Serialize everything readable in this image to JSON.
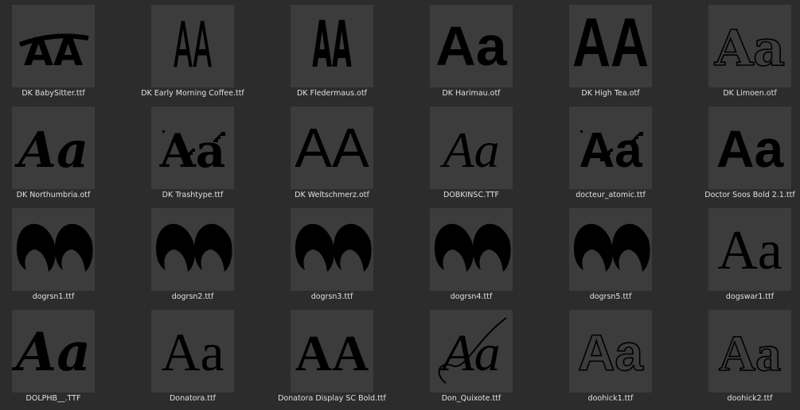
{
  "files": [
    {
      "name": "DK BabySitter.ttf",
      "glyph": "AA"
    },
    {
      "name": "DK Early Morning Coffee.ttf",
      "glyph": "AA"
    },
    {
      "name": "DK Fledermaus.otf",
      "glyph": "AA"
    },
    {
      "name": "DK Harimau.otf",
      "glyph": "Aa"
    },
    {
      "name": "DK High Tea.otf",
      "glyph": "AA"
    },
    {
      "name": "DK Limoen.otf",
      "glyph": "Aa"
    },
    {
      "name": "DK Northumbria.otf",
      "glyph": "Aa"
    },
    {
      "name": "DK Trashtype.ttf",
      "glyph": "Aa"
    },
    {
      "name": "DK Weltschmerz.otf",
      "glyph": "AA"
    },
    {
      "name": "DOBKINSC.TTF",
      "glyph": "Aa"
    },
    {
      "name": "docteur_atomic.ttf",
      "glyph": "Aa"
    },
    {
      "name": "Doctor Soos Bold 2.1.ttf",
      "glyph": "Aa"
    },
    {
      "name": "dogrsn1.ttf",
      "glyph": ""
    },
    {
      "name": "dogrsn2.ttf",
      "glyph": ""
    },
    {
      "name": "dogrsn3.ttf",
      "glyph": ""
    },
    {
      "name": "dogrsn4.ttf",
      "glyph": ""
    },
    {
      "name": "dogrsn5.ttf",
      "glyph": ""
    },
    {
      "name": "dogswar1.ttf",
      "glyph": "Aa"
    },
    {
      "name": "DOLPHB__.TTF",
      "glyph": "Aa"
    },
    {
      "name": "Donatora.ttf",
      "glyph": "Aa"
    },
    {
      "name": "Donatora Display SC Bold.ttf",
      "glyph": "AA"
    },
    {
      "name": "Don_Quixote.ttf",
      "glyph": "Aa"
    },
    {
      "name": "doohick1.ttf",
      "glyph": "Aa"
    },
    {
      "name": "doohick2.ttf",
      "glyph": "Aa"
    }
  ]
}
